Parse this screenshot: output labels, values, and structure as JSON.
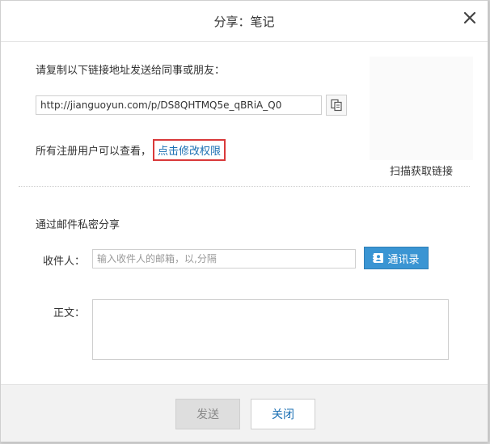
{
  "dialog": {
    "title": "分享：笔记",
    "close_icon": "close-icon"
  },
  "share_link": {
    "label": "请复制以下链接地址发送给同事或朋友：",
    "url": "http://jianguoyun.com/p/DS8QHTMQ5e_qBRiA_Q0",
    "copy_icon": "copy-icon"
  },
  "permission": {
    "text": "所有注册用户可以查看，",
    "link_label": "点击修改权限",
    "highlight_color": "#d9393a"
  },
  "qr": {
    "label": "扫描获取链接"
  },
  "email": {
    "heading": "通过邮件私密分享",
    "recipient_label": "收件人：",
    "recipient_placeholder": "输入收件人的邮箱，以,分隔",
    "contacts_label": "通讯录",
    "contacts_icon": "address-book-icon",
    "body_label": "正文："
  },
  "footer": {
    "send_label": "发送",
    "close_label": "关闭"
  },
  "colors": {
    "accent": "#3a95d3",
    "link": "#1a6fb3"
  }
}
